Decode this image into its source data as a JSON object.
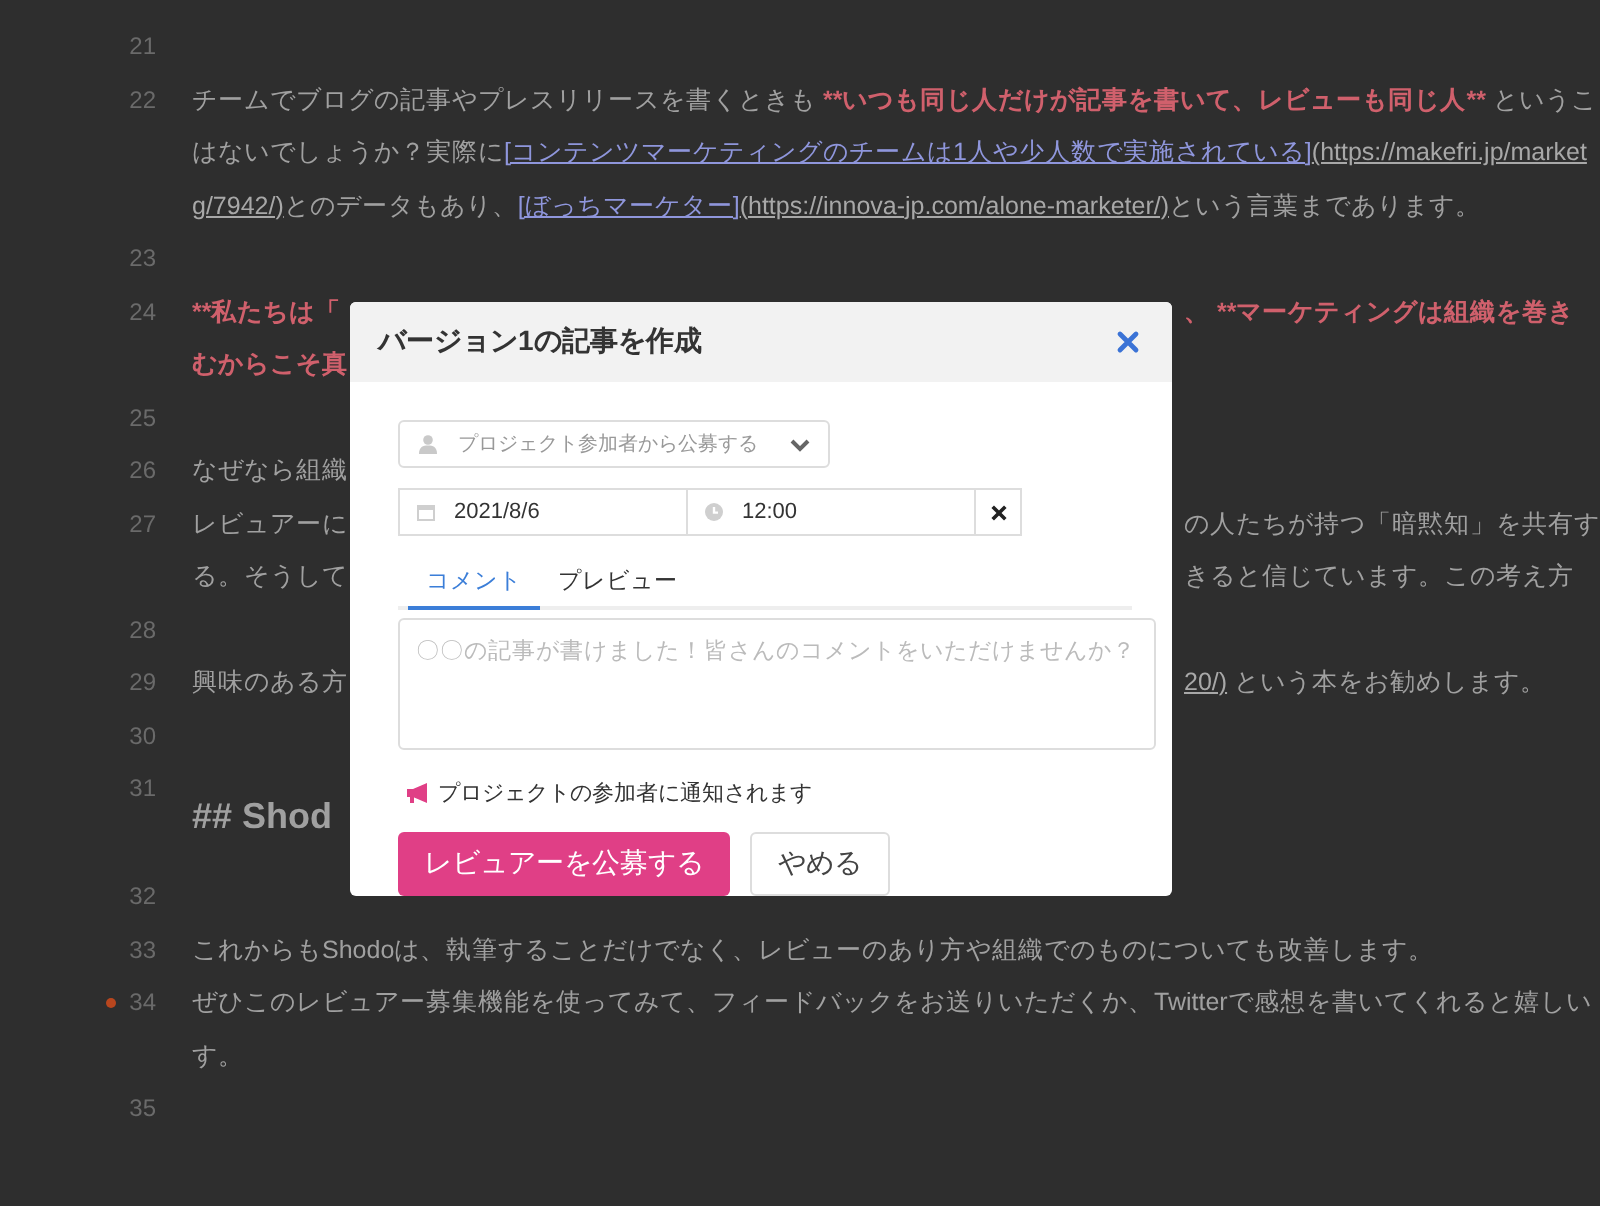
{
  "editor": {
    "lines": [
      {
        "number": "21",
        "marked": false,
        "kind": "text"
      },
      {
        "number": "22",
        "marked": false,
        "kind": "text",
        "rows": [
          {
            "left": [
              {
                "kind": "plain",
                "text": "チームでブログの記事やプレスリリースを書くときも "
              },
              {
                "kind": "bold",
                "text": "**いつも同じ人だけが記事を書いて、レビューも同じ人**"
              },
              {
                "kind": "plain",
                "text": " というこ"
              }
            ]
          },
          {
            "left": [
              {
                "kind": "plain",
                "text": "はないでしょうか？実際に"
              },
              {
                "kind": "link",
                "text": "[コンテンツマーケティングのチームは1人や少人数で実施されている]"
              },
              {
                "kind": "url",
                "text": "(https://makefri.jp/market"
              }
            ]
          },
          {
            "left": [
              {
                "kind": "url",
                "text": "g/7942/)"
              },
              {
                "kind": "plain",
                "text": "とのデータもあり、"
              },
              {
                "kind": "link",
                "text": "[ぼっちマーケター]"
              },
              {
                "kind": "url",
                "text": "(https://innova-jp.com/alone-marketer/)"
              },
              {
                "kind": "plain",
                "text": "という言葉まであります。"
              }
            ]
          }
        ]
      },
      {
        "number": "23",
        "marked": false,
        "kind": "text"
      },
      {
        "number": "24",
        "marked": false,
        "kind": "text",
        "rows": [
          {
            "left": [
              {
                "kind": "bold",
                "text": "**私たちは「"
              }
            ],
            "right": [
              {
                "kind": "bold",
                "text": "、 **マーケティングは組織を巻き"
              }
            ]
          },
          {
            "left": [
              {
                "kind": "bold",
                "text": "むからこそ真"
              }
            ]
          }
        ]
      },
      {
        "number": "25",
        "marked": false,
        "kind": "text"
      },
      {
        "number": "26",
        "marked": false,
        "kind": "text",
        "rows": [
          {
            "left": [
              {
                "kind": "plain",
                "text": "なぜなら組織"
              }
            ]
          }
        ]
      },
      {
        "number": "27",
        "marked": false,
        "kind": "text",
        "rows": [
          {
            "left": [
              {
                "kind": "plain",
                "text": "レビュアーに"
              }
            ],
            "right": [
              {
                "kind": "plain",
                "text": "の人たちが持つ「暗黙知」を共有す"
              }
            ]
          },
          {
            "left": [
              {
                "kind": "plain",
                "text": "る。そうして"
              }
            ],
            "right": [
              {
                "kind": "plain",
                "text": "きると信じています。この考え方"
              }
            ]
          }
        ]
      },
      {
        "number": "28",
        "marked": false,
        "kind": "text"
      },
      {
        "number": "29",
        "marked": false,
        "kind": "text",
        "rows": [
          {
            "left": [
              {
                "kind": "plain",
                "text": "興味のある方"
              }
            ],
            "right": [
              {
                "kind": "url",
                "text": "20/)"
              },
              {
                "kind": "plain",
                "text": " という本をお勧めします。"
              }
            ]
          }
        ]
      },
      {
        "number": "30",
        "marked": false,
        "kind": "text"
      },
      {
        "number": "31",
        "marked": false,
        "kind": "heading",
        "rows": [
          {
            "left": [
              {
                "kind": "plain",
                "text": "## Shod"
              }
            ]
          }
        ]
      },
      {
        "number": "32",
        "marked": false,
        "kind": "text"
      },
      {
        "number": "33",
        "marked": false,
        "kind": "text",
        "rows": [
          {
            "left": [
              {
                "kind": "plain",
                "text": "これからもShodoは、執筆することだけでなく、レビューのあり方や組織でのものについても改善します。"
              }
            ]
          }
        ]
      },
      {
        "number": "34",
        "marked": true,
        "kind": "text",
        "rows": [
          {
            "left": [
              {
                "kind": "plain",
                "text": "ぜひこのレビュアー募集機能を使ってみて、フィードバックをお送りいただくか、Twitterで感想を書いてくれると嬉しい"
              }
            ]
          },
          {
            "left": [
              {
                "kind": "plain",
                "text": "す。"
              }
            ]
          }
        ]
      },
      {
        "number": "35",
        "marked": false,
        "kind": "text"
      }
    ]
  },
  "modal": {
    "title": "バージョン1の記事を作成",
    "audience": {
      "placeholder": "プロジェクト参加者から公募する"
    },
    "date": {
      "value": "2021/8/6"
    },
    "time": {
      "value": "12:00"
    },
    "tabs": [
      {
        "label": "コメント",
        "selected": true
      },
      {
        "label": "プレビュー",
        "selected": false
      }
    ],
    "comment": {
      "placeholder": "〇〇の記事が書けました！皆さんのコメントをいただけませんか？"
    },
    "notice": "プロジェクトの参加者に通知されます",
    "buttons": [
      {
        "kind": "primary",
        "label": "レビュアーを公募する"
      },
      {
        "kind": "secondary",
        "label": "やめる"
      }
    ]
  }
}
